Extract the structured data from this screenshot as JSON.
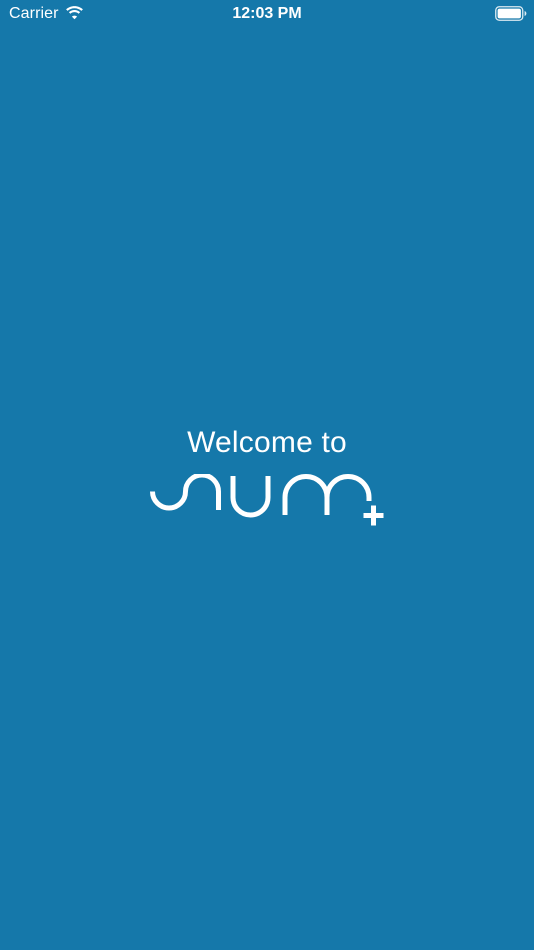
{
  "colors": {
    "background": "#1578aa",
    "foreground": "#ffffff"
  },
  "status_bar": {
    "carrier": "Carrier",
    "time": "12:03 PM",
    "wifi_icon": "wifi-icon",
    "battery_icon": "battery-icon"
  },
  "welcome": {
    "text": "Welcome to",
    "logo_text": "sum+"
  }
}
